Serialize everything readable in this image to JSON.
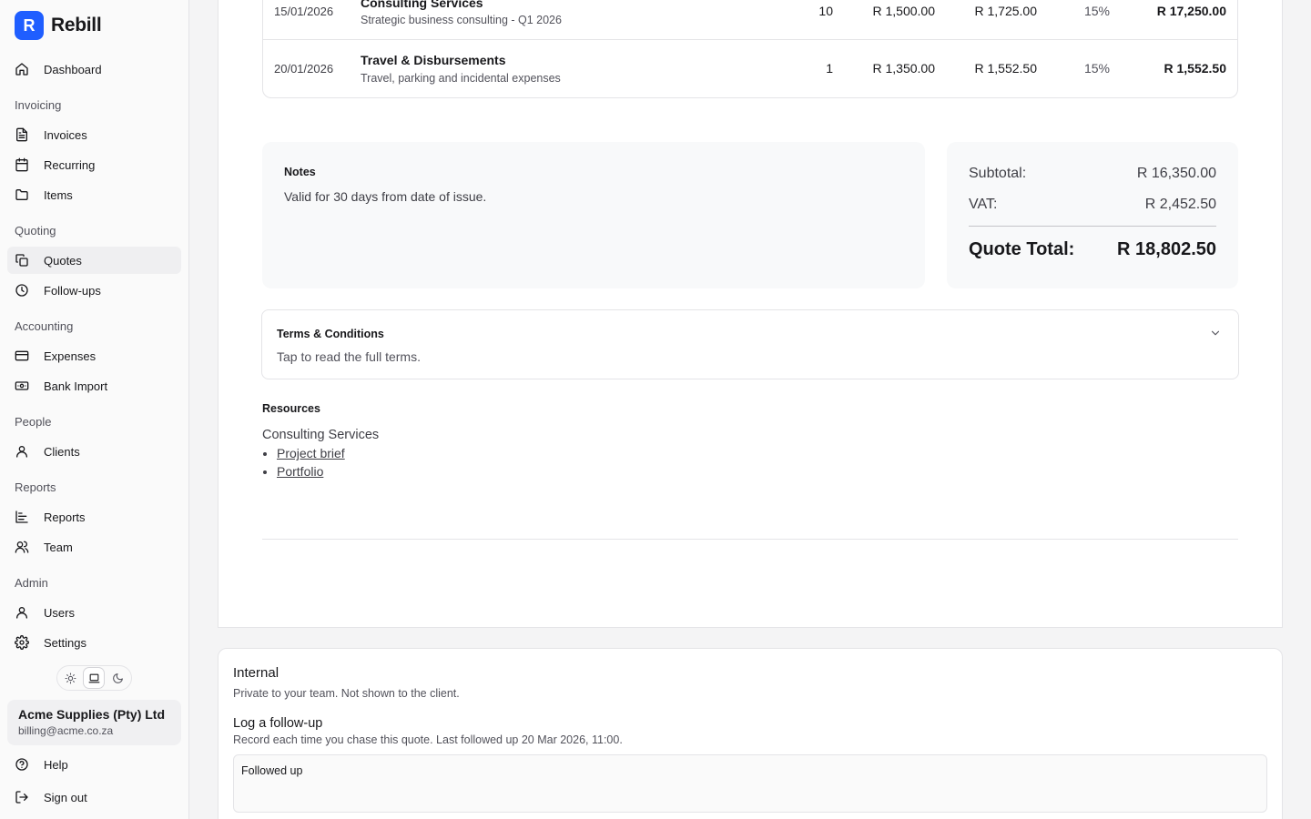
{
  "brand": {
    "logo_letter": "R",
    "name": "Rebill",
    "accent": "#1f5eff"
  },
  "sidebar": {
    "dashboard": "Dashboard",
    "sections": {
      "invoicing": "Invoicing",
      "quoting": "Quoting",
      "accounting": "Accounting",
      "people": "People",
      "reports": "Reports",
      "admin": "Admin"
    },
    "items": {
      "invoices": "Invoices",
      "recurring": "Recurring",
      "items": "Items",
      "quotes": "Quotes",
      "followups": "Follow-ups",
      "expenses": "Expenses",
      "bank_import": "Bank Import",
      "clients": "Clients",
      "reports": "Reports",
      "team": "Team",
      "users": "Users",
      "settings": "Settings"
    },
    "active_item": "quotes",
    "theme_modes": [
      "sun-icon",
      "laptop-icon",
      "moon-icon"
    ],
    "theme_selected": "laptop-icon",
    "account": {
      "name": "Acme Supplies (Pty) Ltd",
      "email": "billing@acme.co.za"
    },
    "help": "Help",
    "sign_out": "Sign out"
  },
  "line_items": [
    {
      "date": "15/01/2026",
      "title": "Consulting Services",
      "description": "Strategic business consulting - Q1 2026",
      "qty": "10",
      "unit_price": "R 1,500.00",
      "unit_incl": "R 1,725.00",
      "vat_rate": "15%",
      "total": "R 17,250.00"
    },
    {
      "date": "20/01/2026",
      "title": "Travel & Disbursements",
      "description": "Travel, parking and incidental expenses",
      "qty": "1",
      "unit_price": "R 1,350.00",
      "unit_incl": "R 1,552.50",
      "vat_rate": "15%",
      "total": "R 1,552.50"
    }
  ],
  "notes": {
    "title": "Notes",
    "text": "Valid for 30 days from date of issue."
  },
  "totals": {
    "subtotal_label": "Subtotal:",
    "subtotal": "R 16,350.00",
    "vat_label": "VAT:",
    "vat": "R 2,452.50",
    "total_label": "Quote Total:",
    "total": "R 18,802.50"
  },
  "terms": {
    "title": "Terms & Conditions",
    "subtitle": "Tap to read the full terms."
  },
  "resources": {
    "title": "Resources",
    "group": "Consulting Services",
    "links": [
      "Project brief",
      "Portfolio"
    ]
  },
  "internal": {
    "title": "Internal",
    "subtitle": "Private to your team. Not shown to the client.",
    "followup_title": "Log a follow-up",
    "followup_subtitle": "Record each time you chase this quote. Last followed up 20 Mar 2026, 11:00.",
    "followup_value": "Followed up"
  }
}
